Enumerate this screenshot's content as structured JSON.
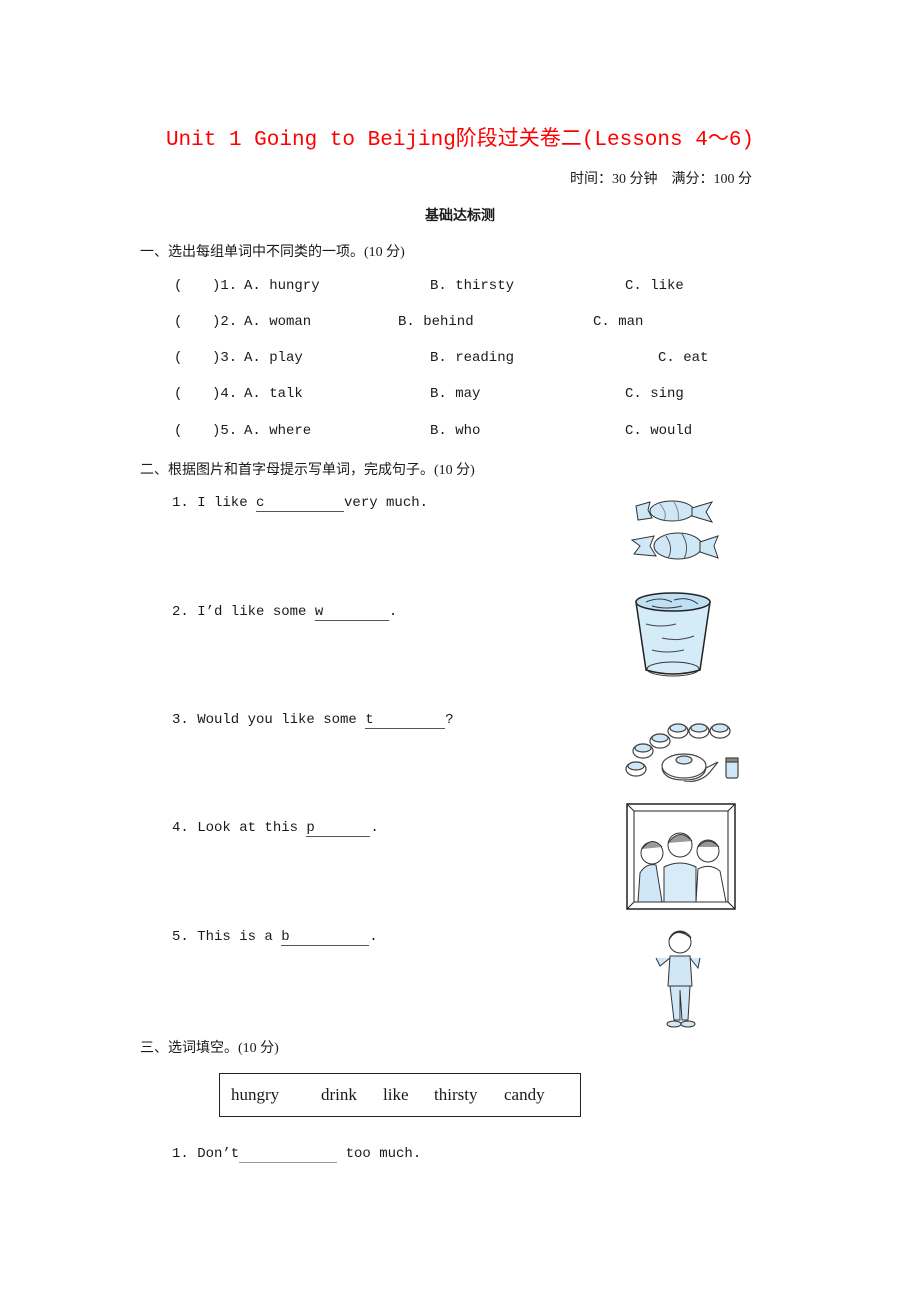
{
  "header": {
    "title": "Unit 1 Going to Beijing阶段过关卷二(Lessons 4～6)",
    "time": "时间：30 分钟",
    "score": "满分：100 分",
    "subtitle": "基础达标测"
  },
  "section1": {
    "heading": "一、选出每组单词中不同类的一项。(10 分)",
    "questions": [
      {
        "paren": "(",
        "num": ")1.",
        "a": "A.  hungry",
        "b": "B.  thirsty",
        "c": "C.  like"
      },
      {
        "paren": "(",
        "num": ")2.",
        "a": "A.  woman",
        "b": "B.  behind",
        "c": "C.  man"
      },
      {
        "paren": "(",
        "num": ")3.",
        "a": "A.  play",
        "b": "B.  reading",
        "c": "C.  eat"
      },
      {
        "paren": "(",
        "num": ")4.",
        "a": "A.  talk",
        "b": "B.  may",
        "c": "C.  sing"
      },
      {
        "paren": "(",
        "num": ")5.",
        "a": "A.  where",
        "b": "B.  who",
        "c": "C.  would"
      }
    ]
  },
  "section2": {
    "heading": "二、根据图片和首字母提示写单词，完成句子。(10 分)",
    "questions": [
      {
        "pre": "1. I like ",
        "hint": "c",
        "post": "very much.",
        "image": "candy-icon"
      },
      {
        "pre": "2. I’d like some ",
        "hint": "w",
        "post": ".",
        "image": "glass-of-water-icon"
      },
      {
        "pre": "3. Would you like some ",
        "hint": "t",
        "post": "?",
        "image": "tea-set-icon"
      },
      {
        "pre": "4. Look at this ",
        "hint": "p",
        "post": ".",
        "image": "framed-photo-icon"
      },
      {
        "pre": "5. This is a ",
        "hint": "b",
        "post": ".",
        "image": "boy-icon"
      }
    ]
  },
  "section3": {
    "heading": "三、选词填空。(10 分)",
    "words": [
      "hungry",
      "drink",
      "like",
      "thirsty",
      "candy"
    ],
    "questions": [
      {
        "pre": "1. Don’t",
        "post": " too much."
      }
    ]
  }
}
